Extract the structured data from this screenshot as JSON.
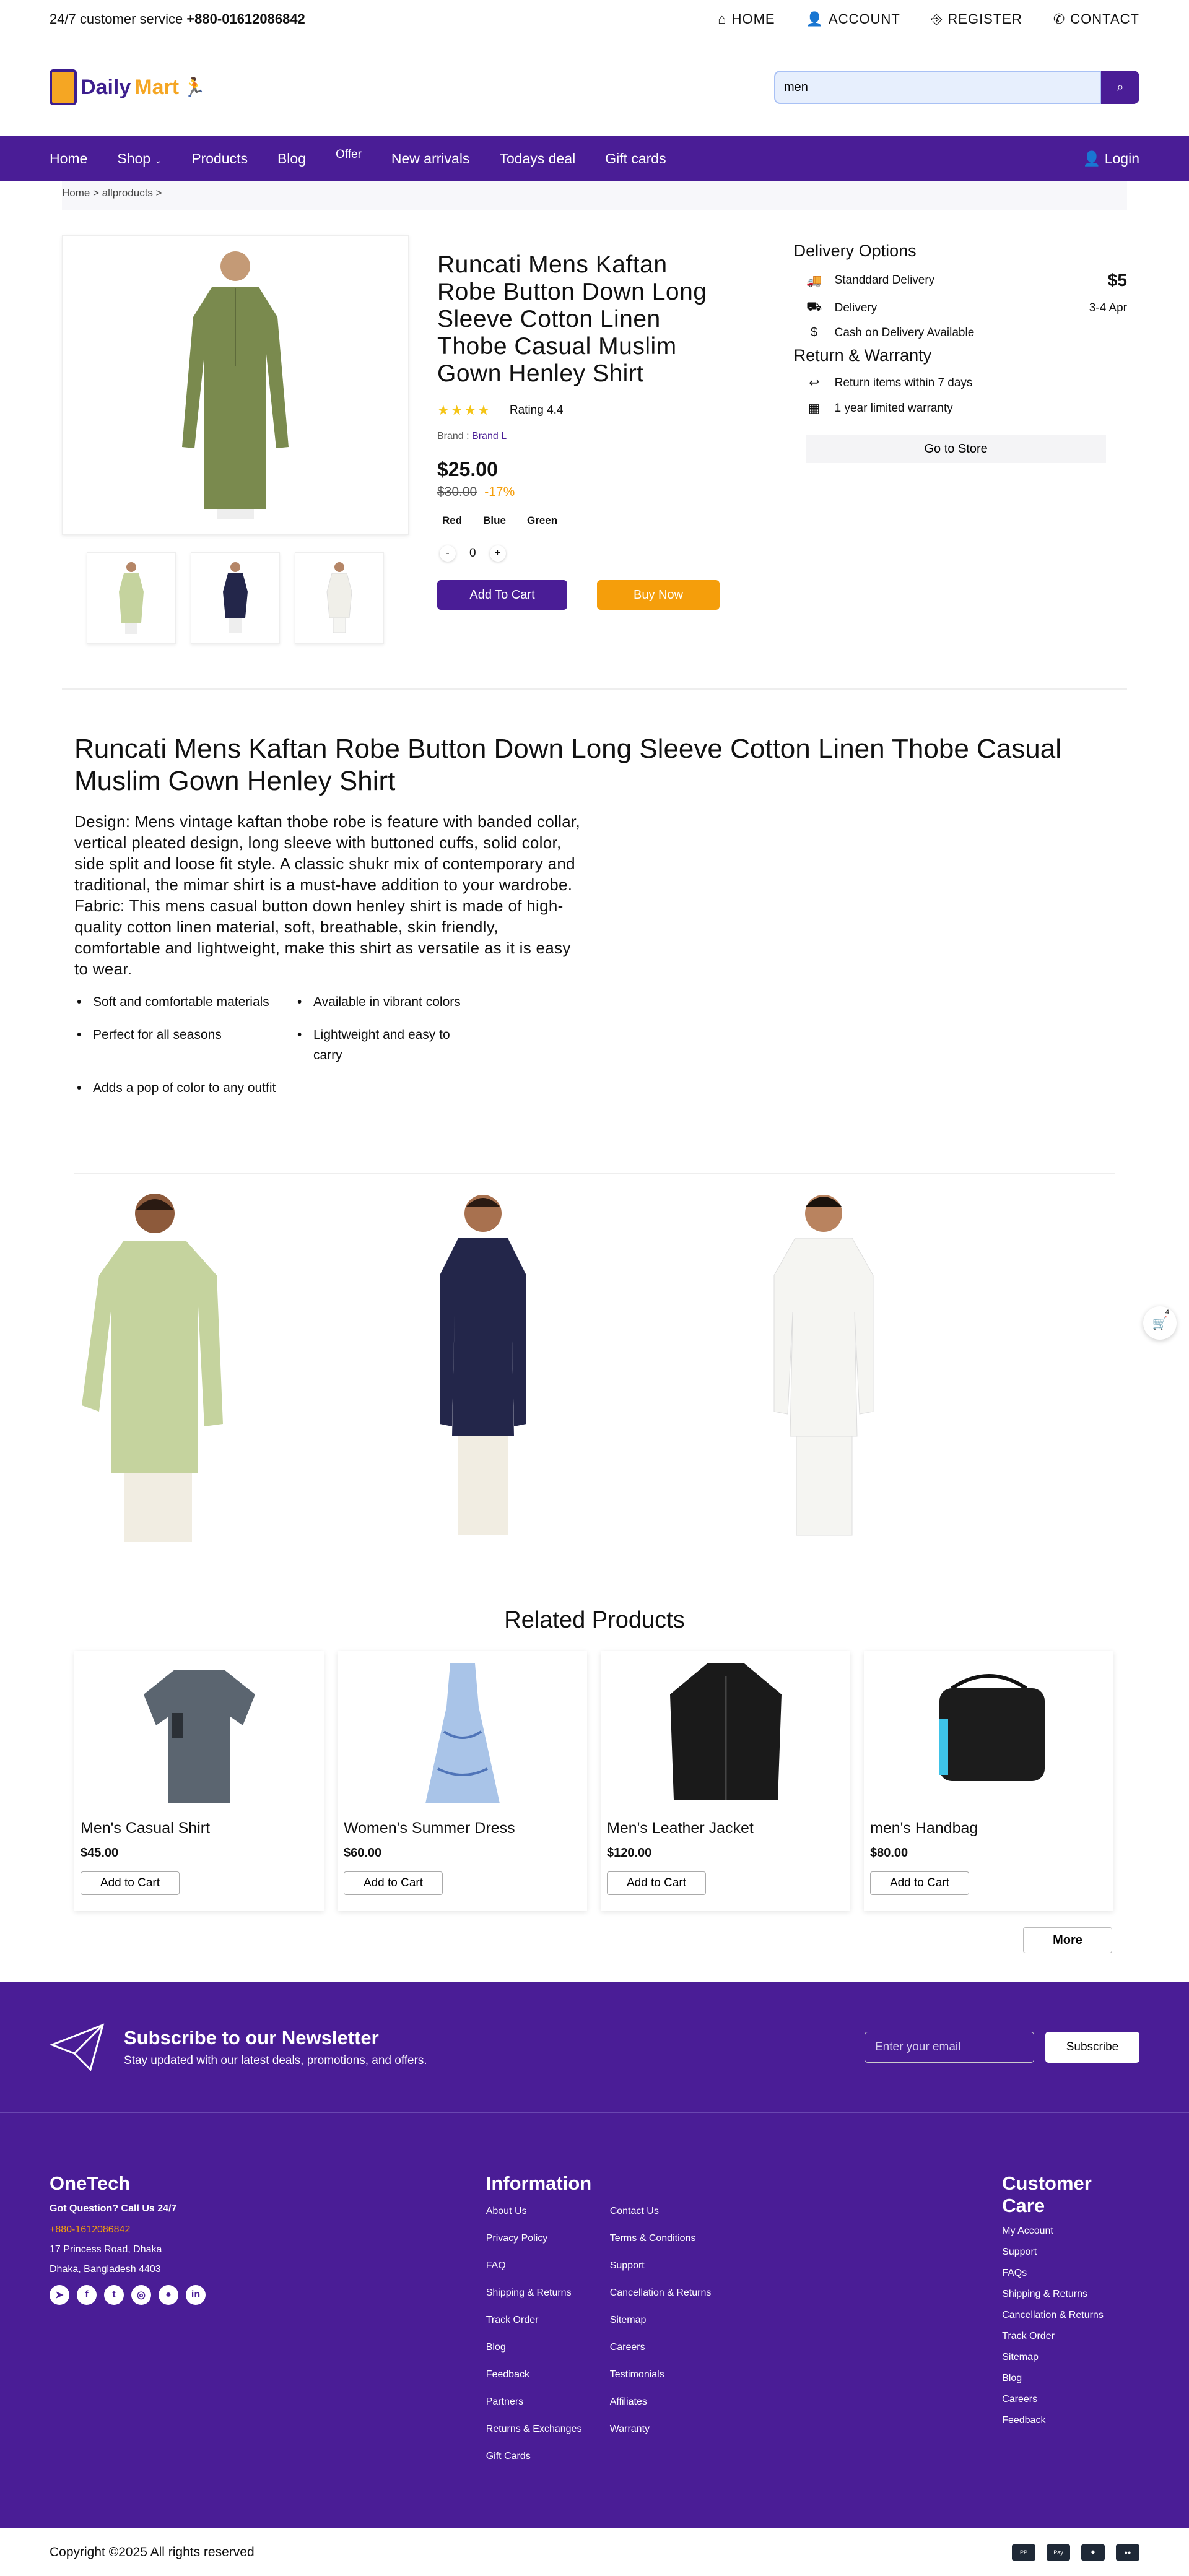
{
  "topbar": {
    "service_label": "24/7 customer service",
    "phone": "+880-01612086842",
    "links": [
      {
        "icon": "home-icon",
        "label": "HOME"
      },
      {
        "icon": "user-icon",
        "label": "ACCOUNT"
      },
      {
        "icon": "register-icon",
        "label": "REGISTER"
      },
      {
        "icon": "phone-icon",
        "label": "CONTACT"
      }
    ]
  },
  "header": {
    "logo_part1": "Daily",
    "logo_part2": "Mart",
    "search_value": "men"
  },
  "nav": {
    "items": [
      "Home",
      "Shop",
      "Products",
      "Blog",
      "Offer",
      "New arrivals",
      "Todays deal",
      "Gift cards"
    ],
    "login": "Login"
  },
  "breadcrumb": "Home > allproducts >",
  "product": {
    "title": "Runcati Mens Kaftan Robe Button Down Long Sleeve Cotton Linen Thobe Casual Muslim Gown Henley Shirt",
    "stars": "★★★★",
    "rating": "Rating 4.4",
    "brand_label": "Brand :",
    "brand": "Brand L",
    "price": "$25.00",
    "old_price": "$30.00",
    "discount": "-17%",
    "colors": [
      "Red",
      "Blue",
      "Green"
    ],
    "qty_minus": "-",
    "qty": "0",
    "qty_plus": "+",
    "add_to_cart": "Add To Cart",
    "buy_now": "Buy Now"
  },
  "delivery": {
    "title": "Delivery Options",
    "rows": [
      {
        "icon": "truck-icon",
        "label": "Standdard Delivery",
        "value": "$5"
      },
      {
        "icon": "delivery-truck-icon",
        "label": "Delivery",
        "value": "3-4 Apr"
      },
      {
        "icon": "cash-icon",
        "label": "Cash on Delivery Available",
        "value": ""
      }
    ],
    "return_title": "Return & Warranty",
    "return_rows": [
      {
        "icon": "return-icon",
        "label": "Return items within 7 days"
      },
      {
        "icon": "calendar-icon",
        "label": "1 year limited warranty"
      }
    ],
    "go_store": "Go to Store"
  },
  "description": {
    "title": "Runcati Mens Kaftan Robe Button Down Long Sleeve Cotton Linen Thobe Casual Muslim Gown Henley Shirt",
    "text": "Design: Mens vintage kaftan thobe robe is feature with banded collar, vertical pleated design, long sleeve with buttoned cuffs, solid color, side split and loose fit style. A classic shukr mix of contemporary and traditional, the mimar shirt is a must-have addition to your wardrobe. Fabric: This mens casual button down henley shirt is made of high-quality cotton linen material, soft, breathable, skin friendly, comfortable and lightweight, make this shirt as versatile as it is easy to wear.",
    "bullets": [
      "Soft and comfortable materials",
      "Available in vibrant colors",
      "Perfect for all seasons",
      "Lightweight and easy to carry",
      "Adds a pop of color to any outfit"
    ]
  },
  "colors": {
    "primary": "#4a1d96",
    "accent": "#f59e0b",
    "robe_green": "#7a8a4e",
    "robe_navy": "#23264a",
    "robe_white": "#f5f5f2",
    "robe_pistachio": "#c5d39e"
  },
  "related": {
    "title": "Related Products",
    "items": [
      {
        "name": "Men's Casual Shirt",
        "price": "$45.00",
        "button": "Add to Cart"
      },
      {
        "name": "Women's Summer Dress",
        "price": "$60.00",
        "button": "Add to Cart"
      },
      {
        "name": "Men's Leather Jacket",
        "price": "$120.00",
        "button": "Add to Cart"
      },
      {
        "name": "men's Handbag",
        "price": "$80.00",
        "button": "Add to Cart"
      }
    ],
    "more": "More"
  },
  "cart_count": "4",
  "newsletter": {
    "title": "Subscribe to our Newsletter",
    "subtitle": "Stay updated with our latest deals, promotions, and offers.",
    "placeholder": "Enter your email",
    "button": "Subscribe"
  },
  "footer": {
    "brand": "OneTech",
    "question": "Got Question? Call Us 24/7",
    "phone": "+880-1612086842",
    "address1": "17 Princess Road, Dhaka",
    "address2": "Dhaka, Bangladesh 4403",
    "socials": [
      "telegram-icon",
      "facebook-icon",
      "twitter-icon",
      "instagram-icon",
      "github-icon",
      "linkedin-icon"
    ],
    "info_title": "Information",
    "info_links": [
      "About Us",
      "Contact Us",
      "Privacy Policy",
      "Terms & Conditions",
      "FAQ",
      "Support",
      "Shipping & Returns",
      "Cancellation & Returns",
      "Track Order",
      "Sitemap",
      "Blog",
      "Careers",
      "Feedback",
      "Testimonials",
      "Partners",
      "Affiliates",
      "Returns & Exchanges",
      "Warranty",
      "Gift Cards"
    ],
    "care_title": "Customer Care",
    "care_links": [
      "My Account",
      "Support",
      "FAQs",
      "Shipping & Returns",
      "Cancellation & Returns",
      "Track Order",
      "Sitemap",
      "Blog",
      "Careers",
      "Feedback"
    ]
  },
  "copyright": "Copyright ©2025 All rights reserved",
  "payments": [
    "paypal-icon",
    "applepay-icon",
    "binance-icon",
    "mastercard-icon"
  ]
}
